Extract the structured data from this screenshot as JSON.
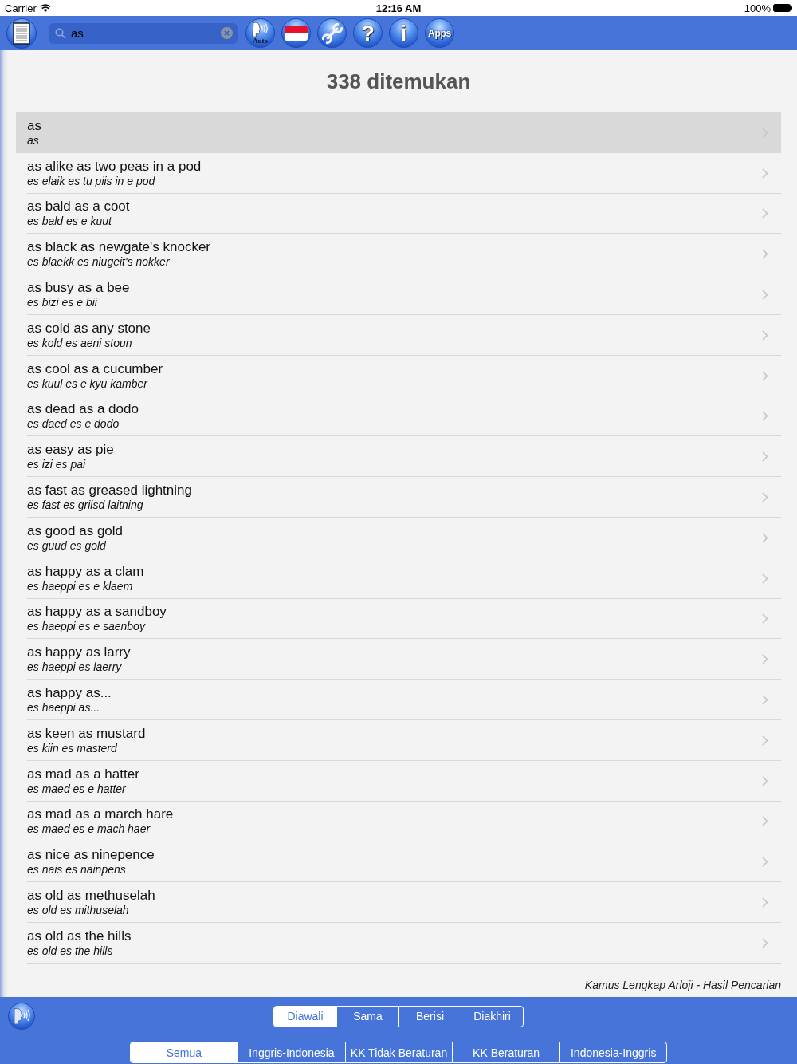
{
  "status_bar": {
    "carrier": "Carrier",
    "time": "12:16 AM",
    "battery": "100%"
  },
  "toolbar": {
    "items": [
      {
        "kind": "book"
      },
      {
        "kind": "search",
        "value": "as"
      },
      {
        "kind": "speaker",
        "label": "Auto"
      },
      {
        "kind": "flag"
      },
      {
        "kind": "wrench"
      },
      {
        "kind": "glyph",
        "label": "?"
      },
      {
        "kind": "glyph",
        "label": "i"
      },
      {
        "kind": "text",
        "label": "Apps"
      }
    ]
  },
  "results": {
    "title": "338 ditemukan",
    "rows": [
      {
        "word": "as",
        "pronunciation": "as",
        "selected": true
      },
      {
        "word": "as alike as two peas in a pod",
        "pronunciation": "es elaik es tu piis in e pod",
        "selected": false
      },
      {
        "word": "as bald as a coot",
        "pronunciation": "es bald es e kuut",
        "selected": false
      },
      {
        "word": "as black as newgate's knocker",
        "pronunciation": "es blaekk es niugeit's nokker",
        "selected": false
      },
      {
        "word": "as busy as a bee",
        "pronunciation": "es bizi es e bii",
        "selected": false
      },
      {
        "word": "as cold as any stone",
        "pronunciation": "es kold es aeni stoun",
        "selected": false
      },
      {
        "word": "as cool as a cucumber",
        "pronunciation": "es kuul es e kyu kamber",
        "selected": false
      },
      {
        "word": "as dead as a dodo",
        "pronunciation": "es daed es e dodo",
        "selected": false
      },
      {
        "word": "as easy as pie",
        "pronunciation": "es izi es pai",
        "selected": false
      },
      {
        "word": "as fast as greased lightning",
        "pronunciation": "es fast es griisd laitning",
        "selected": false
      },
      {
        "word": "as good as gold",
        "pronunciation": "es guud es gold",
        "selected": false
      },
      {
        "word": "as happy as a clam",
        "pronunciation": "es haeppi es e klaem",
        "selected": false
      },
      {
        "word": "as happy as a sandboy",
        "pronunciation": "es haeppi es e saenboy",
        "selected": false
      },
      {
        "word": "as happy as larry",
        "pronunciation": "es haeppi es laerry",
        "selected": false
      },
      {
        "word": "as happy as...",
        "pronunciation": "es haeppi as...",
        "selected": false
      },
      {
        "word": "as keen as mustard",
        "pronunciation": "es kiin es masterd",
        "selected": false
      },
      {
        "word": "as mad as a hatter",
        "pronunciation": "es maed es e hatter",
        "selected": false
      },
      {
        "word": "as mad as a march hare",
        "pronunciation": "es maed es e mach haer",
        "selected": false
      },
      {
        "word": "as nice as ninepence",
        "pronunciation": "es nais es nainpens",
        "selected": false
      },
      {
        "word": "as old as methuselah",
        "pronunciation": "es old es mithuselah",
        "selected": false
      },
      {
        "word": "as old as the hills",
        "pronunciation": "es old es the hills",
        "selected": false
      }
    ],
    "caption": "Kamus Lengkap Arloji - Hasil Pencarian"
  },
  "bottom_bar": {
    "match_modes": [
      {
        "label": "Diawali",
        "selected": true
      },
      {
        "label": "Sama",
        "selected": false
      },
      {
        "label": "Berisi",
        "selected": false
      },
      {
        "label": "Diakhiri",
        "selected": false
      }
    ],
    "dictionaries": [
      {
        "label": "Semua",
        "selected": true
      },
      {
        "label": "Inggris-Indonesia",
        "selected": false
      },
      {
        "label": "KK Tidak Beraturan",
        "selected": false
      },
      {
        "label": "KK Beraturan",
        "selected": false
      },
      {
        "label": "Indonesia-Inggris",
        "selected": false
      }
    ]
  }
}
